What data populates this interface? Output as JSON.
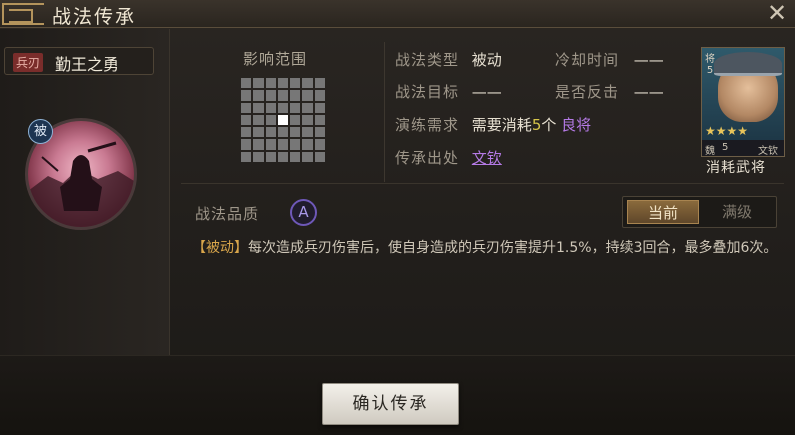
{
  "window": {
    "title": "战法传承",
    "close_label": "✕"
  },
  "skill": {
    "type_tag": "兵刃",
    "name": "勤王之勇",
    "passive_badge": "被"
  },
  "range": {
    "label": "影响范围",
    "grid_size": 7,
    "highlight": [
      3,
      3
    ]
  },
  "info": {
    "type_label": "战法类型",
    "type_value": "被动",
    "cooldown_label": "冷却时间",
    "cooldown_value": "——",
    "target_label": "战法目标",
    "target_value": "——",
    "counter_label": "是否反击",
    "counter_value": "——",
    "practice_label": "演练需求",
    "practice_prefix": "需要消耗",
    "practice_count": "5",
    "practice_unit": "个",
    "practice_quality": "良将",
    "source_label": "传承出处",
    "source_value": "文钦"
  },
  "card": {
    "level_char": "将",
    "level_num": "5",
    "stars": "★★★★",
    "faction": "魏",
    "cost": "5",
    "name": "文钦",
    "consume_label": "消耗武将"
  },
  "quality": {
    "label": "战法品质",
    "grade": "A"
  },
  "toggle": {
    "current_label": "当前",
    "max_label": "满级",
    "selected": "current"
  },
  "description": {
    "tag": "【被动】",
    "text": "每次造成兵刃伤害后，使自身造成的兵刃伤害提升1.5%，持续3回合，最多叠加6次。"
  },
  "confirm_label": "确认传承",
  "colors": {
    "accent_gold": "#d7c64a",
    "accent_purple": "#b57ae6",
    "quality_a": "#6e58b8"
  }
}
